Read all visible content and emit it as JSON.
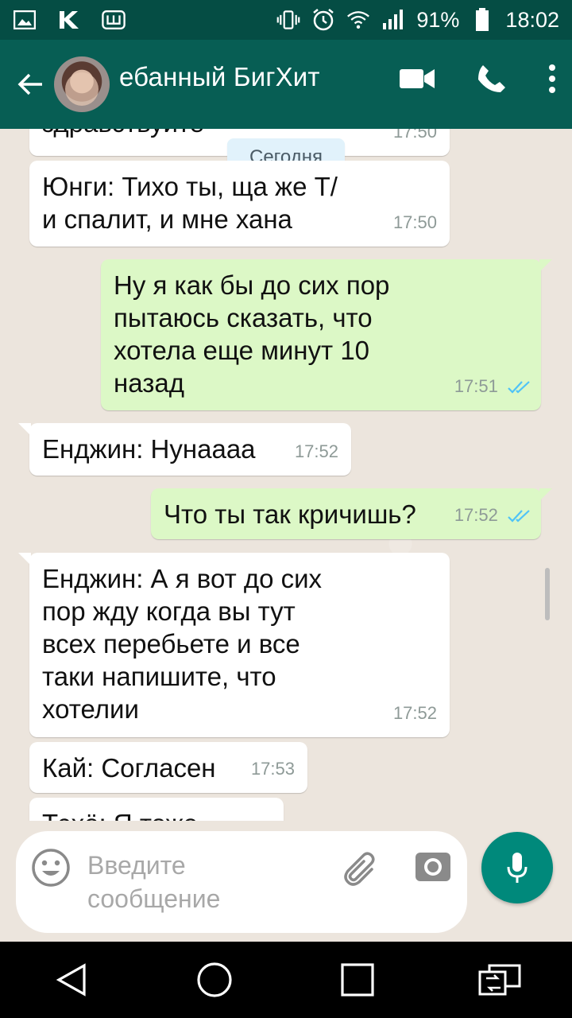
{
  "status_bar": {
    "battery": "91%",
    "time": "18:02",
    "left_icons": [
      "image-icon",
      "vk-icon",
      "notification-box-icon"
    ],
    "right_icons": [
      "vibrate-icon",
      "alarm-icon",
      "wifi-icon",
      "signal-icon",
      "battery-icon"
    ]
  },
  "header": {
    "title": "ебанный БигХит",
    "actions": [
      "video-call-icon",
      "phone-icon",
      "more-vert-icon"
    ]
  },
  "chat": {
    "date_label": "Сегодня",
    "messages": [
      {
        "dir": "in",
        "text": "здравствуйте",
        "time": "17:50"
      },
      {
        "dir": "in",
        "text_lines": [
          "Юнги: Тихо ты, ща же Т/",
          "и спалит, и мне хана"
        ],
        "time": "17:50"
      },
      {
        "dir": "out",
        "text_lines": [
          "Ну я как бы до сих пор",
          "пытаюсь сказать, что",
          "хотела еще минут 10",
          "назад"
        ],
        "time": "17:51"
      },
      {
        "dir": "in",
        "text": "Енджин: Нунаааа",
        "time": "17:52"
      },
      {
        "dir": "out",
        "text": "Что ты так кричишь?",
        "time": "17:52"
      },
      {
        "dir": "in",
        "text_lines": [
          "Енджин: А я вот до сих",
          "пор жду когда вы тут",
          "всех перебьете и все",
          "таки напишите, что",
          "хотелии"
        ],
        "time": "17:52"
      },
      {
        "dir": "in",
        "text": "Кай: Согласен",
        "time": "17:53"
      },
      {
        "dir": "in",
        "text": "Тэхё: Я тоже",
        "time": ""
      }
    ]
  },
  "composer": {
    "placeholder_lines": [
      "Введите",
      "сообщение"
    ],
    "icons": [
      "emoji-icon",
      "attach-icon",
      "camera-icon",
      "mic-icon"
    ]
  },
  "nav": {
    "icons": [
      "back-nav-icon",
      "home-nav-icon",
      "recents-nav-icon",
      "switch-sim-icon"
    ]
  },
  "colors": {
    "header": "#075e54",
    "status_bar": "#054d44",
    "outgoing": "#dcf8c6",
    "incoming": "#ffffff",
    "accent": "#00897b",
    "tick": "#4fc3f7"
  }
}
